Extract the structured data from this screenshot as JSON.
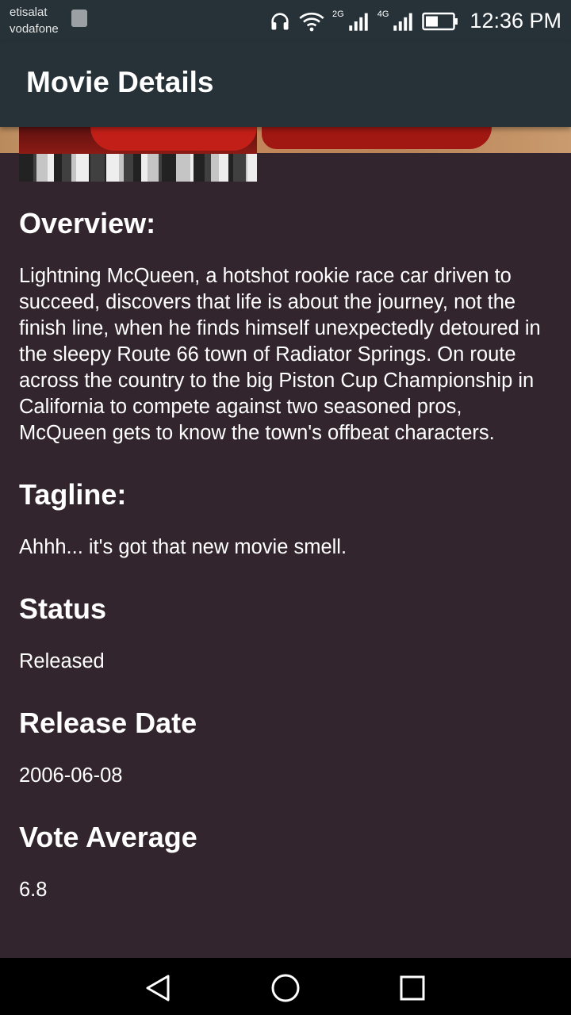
{
  "status_bar": {
    "carrier1": "etisalat",
    "carrier2": "vodafone",
    "net1": "2G",
    "net2": "4G",
    "time": "12:36 PM",
    "icons": [
      "image-icon",
      "headphones-icon",
      "wifi-icon",
      "signal-icon",
      "signal-icon",
      "battery-icon"
    ]
  },
  "app_bar": {
    "title": "Movie Details"
  },
  "sections": {
    "overview": {
      "heading": "Overview:",
      "body": "Lightning McQueen, a hotshot rookie race car driven to succeed, discovers that life is about the journey, not the finish line, when he finds himself unexpectedly detoured in the sleepy Route 66 town of Radiator Springs. On route across the country to the big Piston Cup Championship in California to compete against two seasoned pros, McQueen gets to know the town's offbeat characters."
    },
    "tagline": {
      "heading": "Tagline:",
      "body": "Ahhh... it's got that new movie smell."
    },
    "status": {
      "heading": "Status",
      "body": "Released"
    },
    "release_date": {
      "heading": "Release Date",
      "body": "2006-06-08"
    },
    "vote_average": {
      "heading": "Vote Average",
      "body": "6.8"
    }
  },
  "nav_bar": {
    "icons": [
      "back-icon",
      "home-icon",
      "recents-icon"
    ]
  },
  "colors": {
    "app_bar": "#263238",
    "background": "#33252d",
    "text": "#ffffff"
  }
}
